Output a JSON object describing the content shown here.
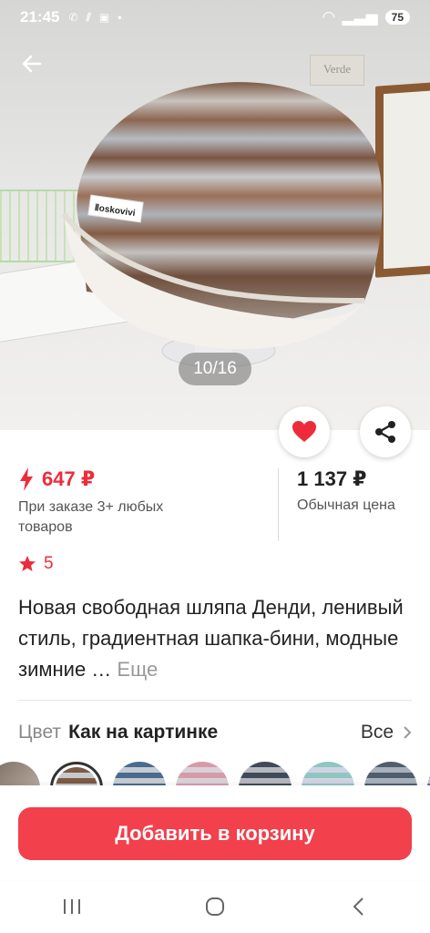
{
  "status_bar": {
    "time": "21:45",
    "battery": "75"
  },
  "gallery": {
    "counter": "10/16",
    "label_on_hat": "Ⅱoskovivi",
    "sign_text": "Verde"
  },
  "actions": {
    "favorite_icon": "heart-icon",
    "share_icon": "share-icon"
  },
  "price": {
    "promo_price": "647 ₽",
    "promo_note": "При заказе 3+ любых товаров",
    "regular_price": "1 137 ₽",
    "regular_label": "Обычная цена",
    "accent": "#ee2b3b"
  },
  "rating": {
    "value": "5"
  },
  "product": {
    "title": "Новая свободная шляпа Денди, ленивый стиль, градиентная шапка-бини, модные зимние …",
    "more": "Еще"
  },
  "color": {
    "label": "Цвет",
    "value": "Как на картинке",
    "all": "Все"
  },
  "cart": {
    "button_label": "Добавить в корзину",
    "color": "#f2404c"
  }
}
